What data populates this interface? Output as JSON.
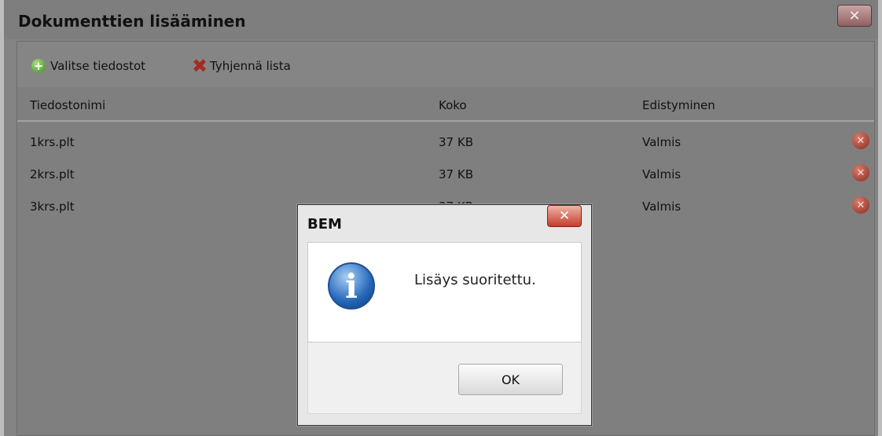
{
  "window": {
    "title": "Dokumenttien lisääminen",
    "close_glyph": "✕",
    "toolbar": {
      "select_files_label": "Valitse tiedostot",
      "clear_list_label": "Tyhjennä lista",
      "add_icon_glyph": "+",
      "clear_icon_glyph": "✖"
    },
    "table": {
      "columns": [
        "Tiedostonimi",
        "Koko",
        "Edistyminen"
      ],
      "rows": [
        {
          "name": "1krs.plt",
          "size": "37 KB",
          "progress": "Valmis"
        },
        {
          "name": "2krs.plt",
          "size": "37 KB",
          "progress": "Valmis"
        },
        {
          "name": "3krs.plt",
          "size": "37 KB",
          "progress": "Valmis"
        }
      ],
      "remove_glyph": "✕"
    }
  },
  "dialog": {
    "title": "BEM",
    "close_glyph": "✕",
    "icon_glyph": "i",
    "message": "Lisäys suoritettu.",
    "ok_label": "OK"
  },
  "colors": {
    "overlay_gray": "#838383",
    "dialog_bg": "#e7e7e7",
    "info_blue": "#2466b9",
    "remove_red": "#8b2d20",
    "add_green": "#3f8a24"
  }
}
